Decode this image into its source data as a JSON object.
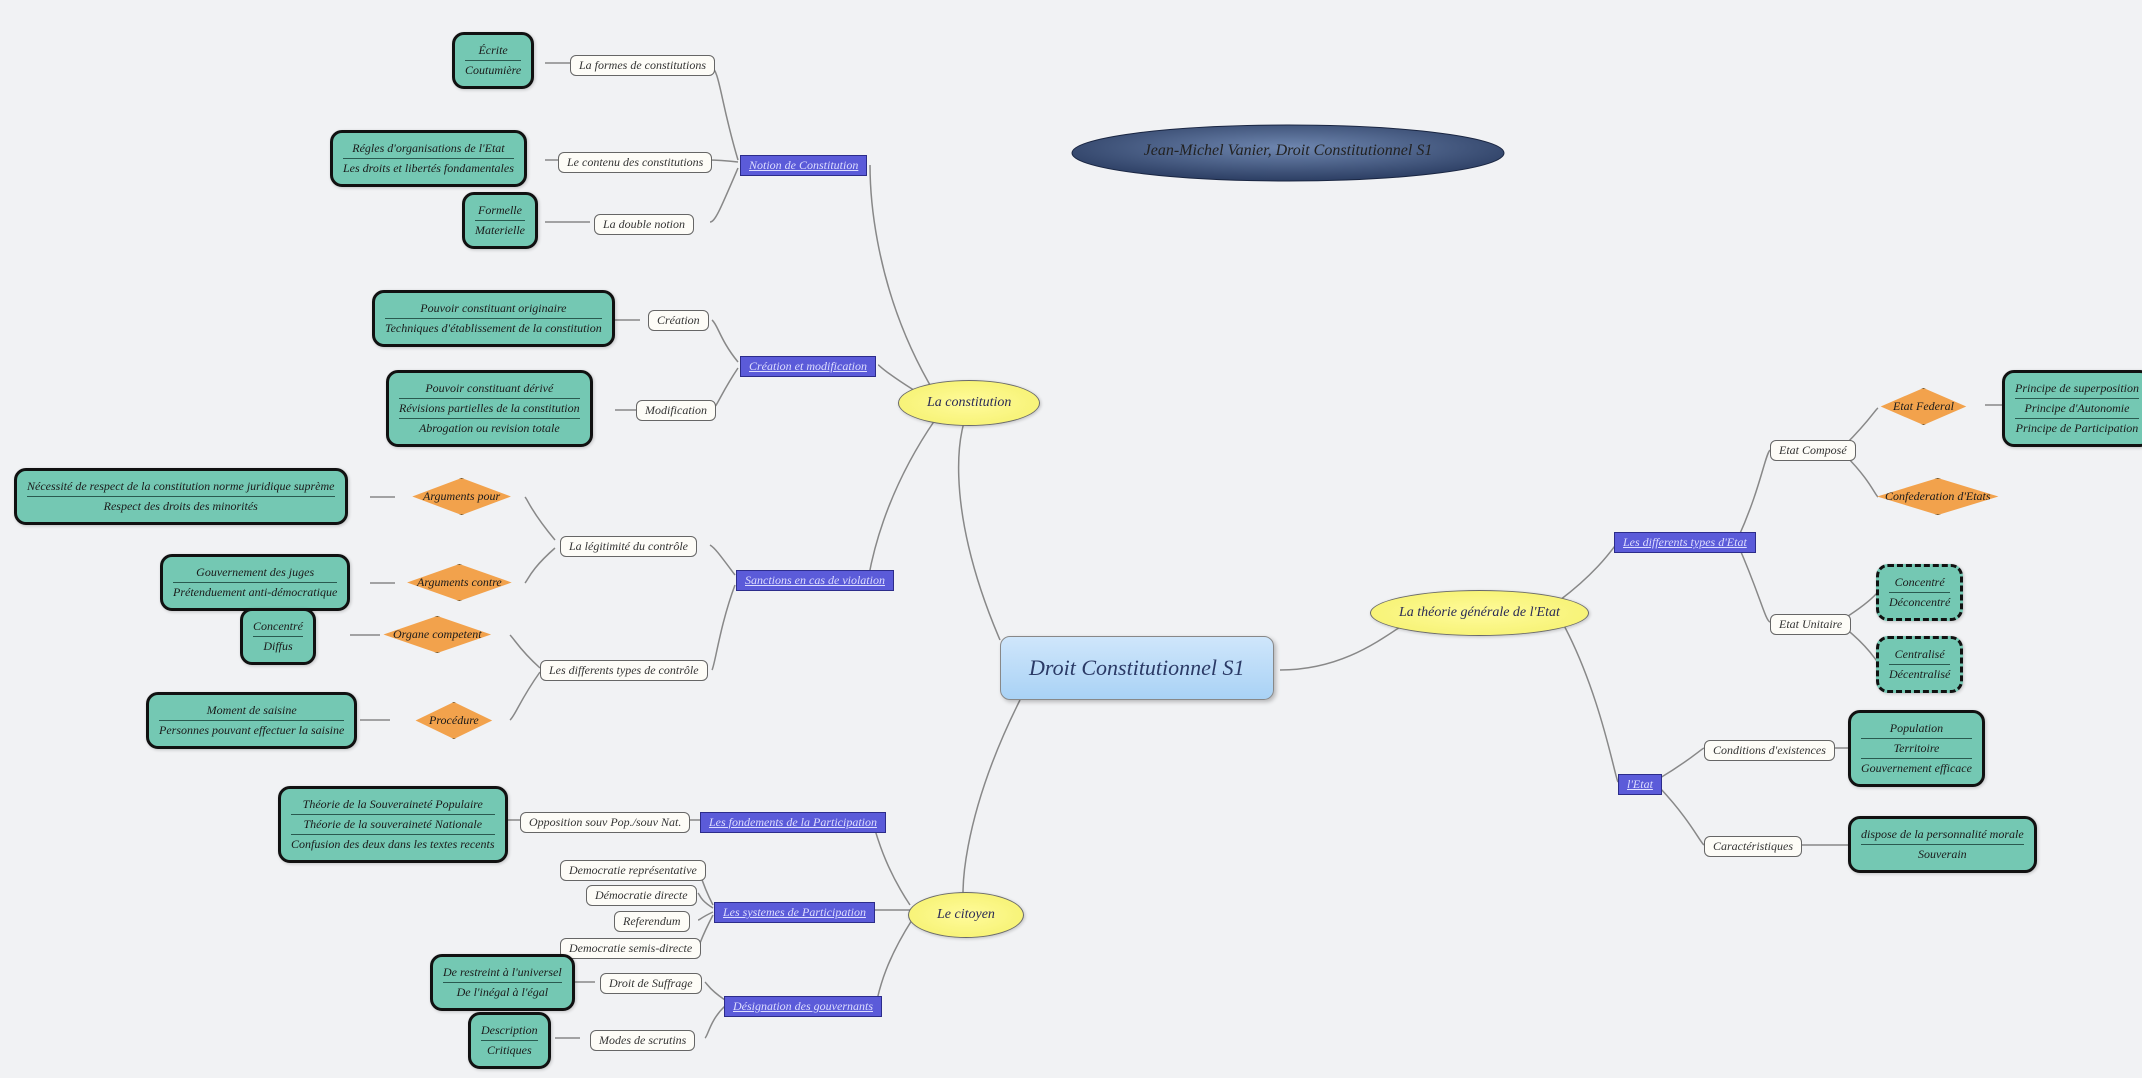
{
  "title": "Jean-Michel Vanier, Droit Constitutionnel S1",
  "root": "Droit Constitutionnel S1",
  "majors": {
    "constitution": "La constitution",
    "citoyen": "Le citoyen",
    "theorie": "La théorie générale de l'Etat"
  },
  "constitution": {
    "notion": {
      "label": "Notion de Constitution",
      "formes": {
        "label": "La formes de constitutions",
        "items": [
          "Écrite",
          "Coutumière"
        ]
      },
      "contenu": {
        "label": "Le contenu des constitutions",
        "items": [
          "Régles d'organisations de l'Etat",
          "Les droits et libertés fondamentales"
        ]
      },
      "double": {
        "label": "La double notion",
        "items": [
          "Formelle",
          "Materielle"
        ]
      }
    },
    "creation": {
      "label": "Création et modification",
      "creation_sub": {
        "label": "Création",
        "items": [
          "Pouvoir constituant originaire",
          "Techniques d'établissement de la constitution"
        ]
      },
      "modification": {
        "label": "Modification",
        "items": [
          "Pouvoir constituant dérivé",
          "Révisions partielles de la constitution",
          "Abrogation ou revision totale"
        ]
      }
    },
    "sanctions": {
      "label": "Sanctions en cas de violation",
      "legitimite": {
        "label": "La légitimité du contrôle",
        "pour": {
          "label": "Arguments pour",
          "items": [
            "Nécessité de respect de la constitution norme juridique suprème",
            "Respect des droits des minorités"
          ]
        },
        "contre": {
          "label": "Arguments contre",
          "items": [
            "Gouvernement des juges",
            "Prétenduement anti-démocratique"
          ]
        }
      },
      "types": {
        "label": "Les differents types de contrôle",
        "organe": {
          "label": "Organe competent",
          "items": [
            "Concentré",
            "Diffus"
          ]
        },
        "procedure": {
          "label": "Procédure",
          "items": [
            "Moment de saisine",
            "Personnes pouvant effectuer la saisine"
          ]
        }
      }
    }
  },
  "citoyen": {
    "fondements": {
      "label": "Les fondements de la Participation",
      "opposition": {
        "label": "Opposition souv Pop./souv Nat.",
        "items": [
          "Théorie de la Souveraineté Populaire",
          "Théorie de la souveraineté Nationale",
          "Confusion des deux dans les textes recents"
        ]
      }
    },
    "systemes": {
      "label": "Les systemes de Participation",
      "items": [
        "Democratie représentative",
        "Démocratie directe",
        "Referendum",
        "Democratie semis-directe"
      ]
    },
    "designation": {
      "label": "Désignation des gouvernants",
      "suffrage": {
        "label": "Droit de Suffrage",
        "items": [
          "De restreint à l'universel",
          "De l'inégal à l'égal"
        ]
      },
      "scrutins": {
        "label": "Modes de scrutins",
        "items": [
          "Description",
          "Critiques"
        ]
      }
    }
  },
  "theorie": {
    "types": {
      "label": "Les differents types d'Etat",
      "compose": {
        "label": "Etat Composé",
        "federal": {
          "label": "Etat Federal",
          "items": [
            "Principe de superposition",
            "Principe d'Autonomie",
            "Principe de Participation"
          ]
        },
        "confederation": {
          "label": "Confederation d'Etats"
        }
      },
      "unitaire": {
        "label": "Etat Unitaire",
        "items1": [
          "Concentré",
          "Déconcentré"
        ],
        "items2": [
          "Centralisé",
          "Décentralisé"
        ]
      }
    },
    "etat": {
      "label": "l'Etat",
      "conditions": {
        "label": "Conditions d'existences",
        "items": [
          "Population",
          "Territoire",
          "Gouvernement efficace"
        ]
      },
      "caracteristiques": {
        "label": "Caractéristiques",
        "items": [
          "dispose de la personnalité morale",
          "Souverain"
        ]
      }
    }
  }
}
